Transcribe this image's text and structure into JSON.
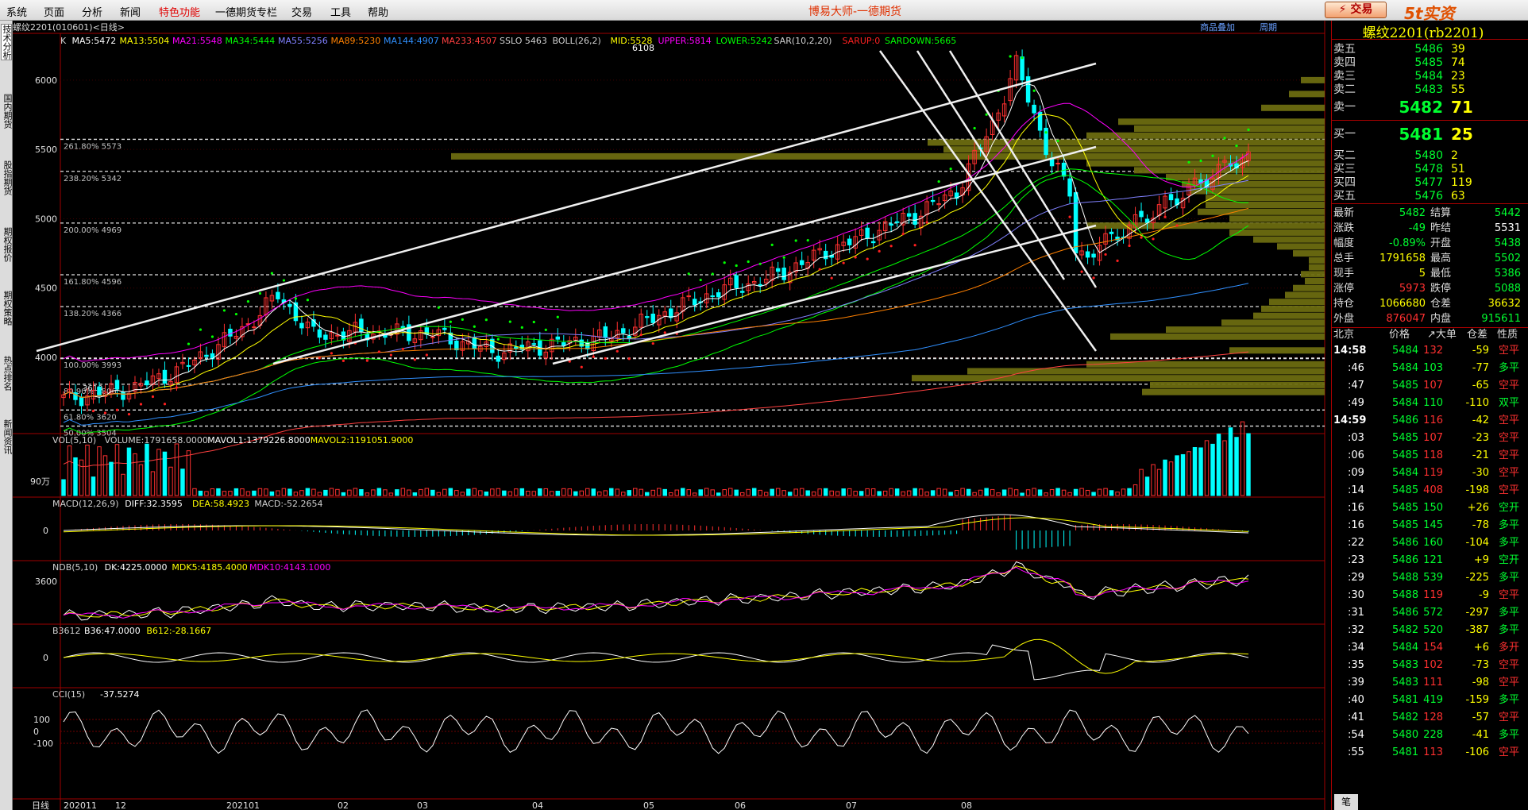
{
  "app": {
    "title": "博易大师-一德期货",
    "trade_button": "⚡ 交易",
    "logo": "5t实资5etz.com"
  },
  "menu": [
    "系统",
    "页面",
    "分析",
    "新闻",
    "特色功能",
    "一德期货专栏",
    "交易",
    "工具",
    "帮助"
  ],
  "left_tabs": [
    "技术分析",
    "国内期货",
    "股指期货",
    "期权报价",
    "期权策略",
    "热点排名",
    "新闻资讯"
  ],
  "chart": {
    "header": "螺纹2201(010601)<日线>",
    "top_links": [
      "商品叠加",
      "周期"
    ],
    "indicator_line": [
      {
        "text": "K",
        "color": "#d0d0d0"
      },
      {
        "text": "MA5:5472",
        "color": "#ffffff"
      },
      {
        "text": "MA13:5504",
        "color": "#ffff00"
      },
      {
        "text": "MA21:5548",
        "color": "#ff00ff"
      },
      {
        "text": "MA34:5444",
        "color": "#00ff00"
      },
      {
        "text": "MA55:5256",
        "color": "#8080ff"
      },
      {
        "text": "MA89:5230",
        "color": "#ff8000"
      },
      {
        "text": "MA144:4907",
        "color": "#3090ff"
      },
      {
        "text": "MA233:4507",
        "color": "#ff4040"
      },
      {
        "text": "SSLO 5463",
        "color": "#d0d0d0"
      },
      {
        "text": "BOLL(26,2)",
        "color": "#d0d0d0"
      },
      {
        "text": "MID:5528",
        "color": "#ffff00"
      },
      {
        "text": "UPPER:5814",
        "color": "#ff00ff"
      },
      {
        "text": "LOWER:5242",
        "color": "#00ff00"
      },
      {
        "text": "SAR(10,2,20)",
        "color": "#d0d0d0"
      },
      {
        "text": "SARUP:0",
        "color": "#ff2020"
      },
      {
        "text": "SARDOWN:5665",
        "color": "#00ff00"
      }
    ],
    "y_ticks": [
      "6000",
      "5500",
      "5000",
      "4500",
      "4000"
    ],
    "peak_label": "6108",
    "fib_levels": [
      {
        "label": "261.80% 5573",
        "price": 5573
      },
      {
        "label": "238.20% 5342",
        "price": 5342
      },
      {
        "label": "200.00% 4969",
        "price": 4969
      },
      {
        "label": "161.80% 4596",
        "price": 4596
      },
      {
        "label": "138.20% 4366",
        "price": 4366
      },
      {
        "label": "100.00% 3993",
        "price": 3993
      },
      {
        "label": "80.90% 3806",
        "price": 3806
      },
      {
        "label": "61.80% 3620",
        "price": 3620
      },
      {
        "label": "50.00% 3504",
        "price": 3504
      }
    ],
    "low_label": "3610",
    "vol": {
      "label": "VOL(5,10)",
      "volume": "VOLUME:1791658.0000",
      "mavol1": "MAVOL1:1379226.8000",
      "mavol2": "MAVOL2:1191051.9000",
      "tick": "90万"
    },
    "macd": {
      "label": "MACD(12,26,9)",
      "diff": "DIFF:32.3595",
      "dea": "DEA:58.4923",
      "macd": "MACD:-52.2654",
      "tick": "0"
    },
    "ndb": {
      "label": "NDB(5,10)",
      "dk": "DK:4225.0000",
      "mdk5": "MDK5:4185.4000",
      "mdk10": "MDK10:4143.1000",
      "tick": "3600"
    },
    "b3612": {
      "label": "B3612",
      "b36": "B36:47.0000",
      "b612": "B612:-28.1667",
      "tick": "0"
    },
    "cci": {
      "label": "CCI(15)",
      "val": "-37.5274",
      "ticks": [
        "100",
        "0",
        "-100"
      ]
    },
    "x_axis": [
      "日线",
      "202011",
      "12",
      "202101",
      "02",
      "03",
      "04",
      "05",
      "06",
      "07",
      "08"
    ]
  },
  "quote": {
    "title": "螺纹2201(rb2201)",
    "asks": [
      {
        "l": "卖五",
        "p": "5486",
        "v": "39"
      },
      {
        "l": "卖四",
        "p": "5485",
        "v": "74"
      },
      {
        "l": "卖三",
        "p": "5484",
        "v": "23"
      },
      {
        "l": "卖二",
        "p": "5483",
        "v": "55"
      },
      {
        "l": "卖一",
        "p": "5482",
        "v": "71"
      }
    ],
    "bids": [
      {
        "l": "买一",
        "p": "5481",
        "v": "25"
      },
      {
        "l": "买二",
        "p": "5480",
        "v": "2"
      },
      {
        "l": "买三",
        "p": "5478",
        "v": "51"
      },
      {
        "l": "买四",
        "p": "5477",
        "v": "119"
      },
      {
        "l": "买五",
        "p": "5476",
        "v": "63"
      }
    ],
    "stats": [
      {
        "l1": "最新",
        "v1": "5482",
        "c1": "#00ff30",
        "l2": "结算",
        "v2": "5442",
        "c2": "#00ff30"
      },
      {
        "l1": "涨跌",
        "v1": "-49",
        "c1": "#00ff30",
        "l2": "昨结",
        "v2": "5531",
        "c2": "#ffffff"
      },
      {
        "l1": "幅度",
        "v1": "-0.89%",
        "c1": "#00ff30",
        "l2": "开盘",
        "v2": "5438",
        "c2": "#00ff30"
      },
      {
        "l1": "总手",
        "v1": "1791658",
        "c1": "#ffff00",
        "l2": "最高",
        "v2": "5502",
        "c2": "#00ff30"
      },
      {
        "l1": "现手",
        "v1": "5",
        "c1": "#ffff00",
        "l2": "最低",
        "v2": "5386",
        "c2": "#00ff30"
      },
      {
        "l1": "涨停",
        "v1": "5973",
        "c1": "#ff3030",
        "l2": "跌停",
        "v2": "5088",
        "c2": "#00ff30"
      },
      {
        "l1": "持仓",
        "v1": "1066680",
        "c1": "#ffff00",
        "l2": "仓差",
        "v2": "36632",
        "c2": "#ffff00"
      },
      {
        "l1": "外盘",
        "v1": "876047",
        "c1": "#ff3030",
        "l2": "内盘",
        "v2": "915611",
        "c2": "#00ff30"
      }
    ],
    "trade_header": [
      "北京",
      "价格",
      "↗大单",
      "仓差",
      "性质"
    ],
    "trades": [
      {
        "t": "14:58",
        "p": "5484",
        "v": "132",
        "vc": "#ff3030",
        "d": "-59",
        "dc": "#ffff00",
        "n": "空平",
        "nc": "#ff3030"
      },
      {
        "t": ":46",
        "p": "5484",
        "v": "103",
        "vc": "#00ff30",
        "d": "-77",
        "dc": "#ffff00",
        "n": "多平",
        "nc": "#00ff30"
      },
      {
        "t": ":47",
        "p": "5485",
        "v": "107",
        "vc": "#ff3030",
        "d": "-65",
        "dc": "#ffff00",
        "n": "空平",
        "nc": "#ff3030"
      },
      {
        "t": ":49",
        "p": "5484",
        "v": "110",
        "vc": "#00ff30",
        "d": "-110",
        "dc": "#ffff00",
        "n": "双平",
        "nc": "#00ff30"
      },
      {
        "t": "14:59",
        "p": "5486",
        "v": "116",
        "vc": "#ff3030",
        "d": "-42",
        "dc": "#ffff00",
        "n": "空平",
        "nc": "#ff3030"
      },
      {
        "t": ":03",
        "p": "5485",
        "v": "107",
        "vc": "#ff3030",
        "d": "-23",
        "dc": "#ffff00",
        "n": "空平",
        "nc": "#ff3030"
      },
      {
        "t": ":06",
        "p": "5485",
        "v": "118",
        "vc": "#ff3030",
        "d": "-21",
        "dc": "#ffff00",
        "n": "空平",
        "nc": "#ff3030"
      },
      {
        "t": ":09",
        "p": "5484",
        "v": "119",
        "vc": "#ff3030",
        "d": "-30",
        "dc": "#ffff00",
        "n": "空平",
        "nc": "#ff3030"
      },
      {
        "t": ":14",
        "p": "5485",
        "v": "408",
        "vc": "#ff3030",
        "d": "-198",
        "dc": "#ffff00",
        "n": "空平",
        "nc": "#ff3030"
      },
      {
        "t": ":16",
        "p": "5485",
        "v": "150",
        "vc": "#00ff30",
        "d": "+26",
        "dc": "#ffff00",
        "n": "空开",
        "nc": "#00ff30"
      },
      {
        "t": ":16",
        "p": "5485",
        "v": "145",
        "vc": "#00ff30",
        "d": "-78",
        "dc": "#ffff00",
        "n": "多平",
        "nc": "#00ff30"
      },
      {
        "t": ":22",
        "p": "5486",
        "v": "160",
        "vc": "#00ff30",
        "d": "-104",
        "dc": "#ffff00",
        "n": "多平",
        "nc": "#00ff30"
      },
      {
        "t": ":23",
        "p": "5486",
        "v": "121",
        "vc": "#00ff30",
        "d": "+9",
        "dc": "#ffff00",
        "n": "空开",
        "nc": "#00ff30"
      },
      {
        "t": ":29",
        "p": "5488",
        "v": "539",
        "vc": "#00ff30",
        "d": "-225",
        "dc": "#ffff00",
        "n": "多平",
        "nc": "#00ff30"
      },
      {
        "t": ":30",
        "p": "5488",
        "v": "119",
        "vc": "#ff3030",
        "d": "-9",
        "dc": "#ffff00",
        "n": "空平",
        "nc": "#ff3030"
      },
      {
        "t": ":31",
        "p": "5486",
        "v": "572",
        "vc": "#00ff30",
        "d": "-297",
        "dc": "#ffff00",
        "n": "多平",
        "nc": "#00ff30"
      },
      {
        "t": ":32",
        "p": "5482",
        "v": "520",
        "vc": "#00ff30",
        "d": "-387",
        "dc": "#ffff00",
        "n": "多平",
        "nc": "#00ff30"
      },
      {
        "t": ":34",
        "p": "5484",
        "v": "154",
        "vc": "#ff3030",
        "d": "+6",
        "dc": "#ffff00",
        "n": "多开",
        "nc": "#ff3030"
      },
      {
        "t": ":35",
        "p": "5483",
        "v": "102",
        "vc": "#ff3030",
        "d": "-73",
        "dc": "#ffff00",
        "n": "空平",
        "nc": "#ff3030"
      },
      {
        "t": ":39",
        "p": "5483",
        "v": "111",
        "vc": "#ff3030",
        "d": "-98",
        "dc": "#ffff00",
        "n": "空平",
        "nc": "#ff3030"
      },
      {
        "t": ":40",
        "p": "5481",
        "v": "419",
        "vc": "#00ff30",
        "d": "-159",
        "dc": "#ffff00",
        "n": "多平",
        "nc": "#00ff30"
      },
      {
        "t": ":41",
        "p": "5482",
        "v": "128",
        "vc": "#ff3030",
        "d": "-57",
        "dc": "#ffff00",
        "n": "空平",
        "nc": "#ff3030"
      },
      {
        "t": ":54",
        "p": "5480",
        "v": "228",
        "vc": "#00ff30",
        "d": "-41",
        "dc": "#ffff00",
        "n": "多平",
        "nc": "#00ff30"
      },
      {
        "t": ":55",
        "p": "5481",
        "v": "113",
        "vc": "#ff3030",
        "d": "-106",
        "dc": "#ffff00",
        "n": "空平",
        "nc": "#ff3030"
      }
    ],
    "bottom_tab": "笔"
  }
}
